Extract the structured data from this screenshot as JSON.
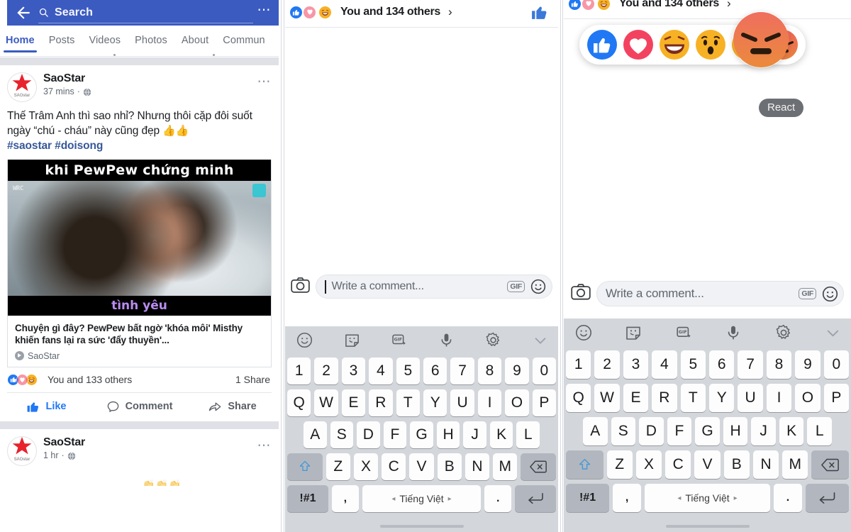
{
  "header": {
    "back_icon": "back-arrow-icon",
    "search_icon": "search-icon",
    "search_placeholder": "Search",
    "menu_icon": "overflow-menu-icon",
    "brand_color": "#3b5bc0"
  },
  "tabs": [
    {
      "label": "Home",
      "active": true
    },
    {
      "label": "Posts",
      "active": false
    },
    {
      "label": "Videos",
      "active": false
    },
    {
      "label": "Photos",
      "active": false
    },
    {
      "label": "About",
      "active": false
    },
    {
      "label": "Commun",
      "active": false
    }
  ],
  "posts": [
    {
      "page_name": "SaoStar",
      "avatar_brand": "SAOstar",
      "time": "37 mins",
      "privacy_icon": "globe-icon",
      "menu_icon": "overflow-menu-icon",
      "body_line1": "Thế Trâm Anh thì sao nhỉ? Nhưng thôi cặp đôi suốt",
      "body_line2": "ngày “chú - cháu” này cũng đẹp",
      "body_emoji": "👍👍",
      "hashtags": "#saostar #doisong",
      "attachment": {
        "meme_top_text": "khi PewPew chứng minh",
        "meme_bottom_text": "tình yêu",
        "watermark_left": "WRC",
        "title": "Chuyện gì đây? PewPew bất ngờ 'khóa môi' Misthy khiến fans lại ra sức 'đẩy thuyền'...",
        "source": "SaoStar"
      },
      "reactions_text": "You and 133 others",
      "shares_text": "1 Share",
      "actions": [
        {
          "label": "Like",
          "icon": "thumbs-up-icon",
          "active": true
        },
        {
          "label": "Comment",
          "icon": "comment-bubble-icon",
          "active": false
        },
        {
          "label": "Share",
          "icon": "share-arrow-icon",
          "active": false
        }
      ]
    },
    {
      "page_name": "SaoStar",
      "avatar_brand": "SAOstar",
      "time": "1 hr",
      "privacy_icon": "globe-icon",
      "menu_icon": "overflow-menu-icon"
    }
  ],
  "middle_panel": {
    "reactions_text": "You and 134 others",
    "chevron": "›",
    "like_button_icon": "thumbs-up-icon",
    "composer": {
      "camera_icon": "camera-icon",
      "placeholder": "Write a comment...",
      "gif_label": "GIF",
      "emoji_icon": "smiley-icon"
    },
    "keyboard_toolbar": [
      "smiley-icon",
      "sticker-icon",
      "gif-icon",
      "microphone-icon",
      "gear-icon",
      "chevron-down-icon"
    ]
  },
  "right_panel": {
    "reactions_text": "You and 134 others",
    "chevron": "›",
    "reaction_picker": {
      "options": [
        "Like",
        "Love",
        "Haha",
        "Wow",
        "Sad",
        "Angry"
      ],
      "hovered": "Angry",
      "tooltip": "React"
    },
    "composer": {
      "camera_icon": "camera-icon",
      "placeholder": "Write a comment...",
      "gif_label": "GIF",
      "emoji_icon": "smiley-icon"
    },
    "keyboard_toolbar": [
      "smiley-icon",
      "sticker-icon",
      "gif-icon",
      "microphone-icon",
      "gear-icon",
      "chevron-down-icon"
    ]
  },
  "keyboard": {
    "row_numbers": [
      "1",
      "2",
      "3",
      "4",
      "5",
      "6",
      "7",
      "8",
      "9",
      "0"
    ],
    "row_top": [
      "Q",
      "W",
      "E",
      "R",
      "T",
      "Y",
      "U",
      "I",
      "O",
      "P"
    ],
    "row_mid": [
      "A",
      "S",
      "D",
      "F",
      "G",
      "H",
      "J",
      "K",
      "L"
    ],
    "row_bot": [
      "Z",
      "X",
      "C",
      "V",
      "B",
      "N",
      "M"
    ],
    "shift_key": "shift-icon",
    "backspace_key": "backspace-icon",
    "symbols_key": "!#1",
    "comma_key": ",",
    "space_key": "Tiếng Việt",
    "space_left_arrow": "◂",
    "space_right_arrow": "▸",
    "period_key": ".",
    "return_key": "return-icon"
  }
}
